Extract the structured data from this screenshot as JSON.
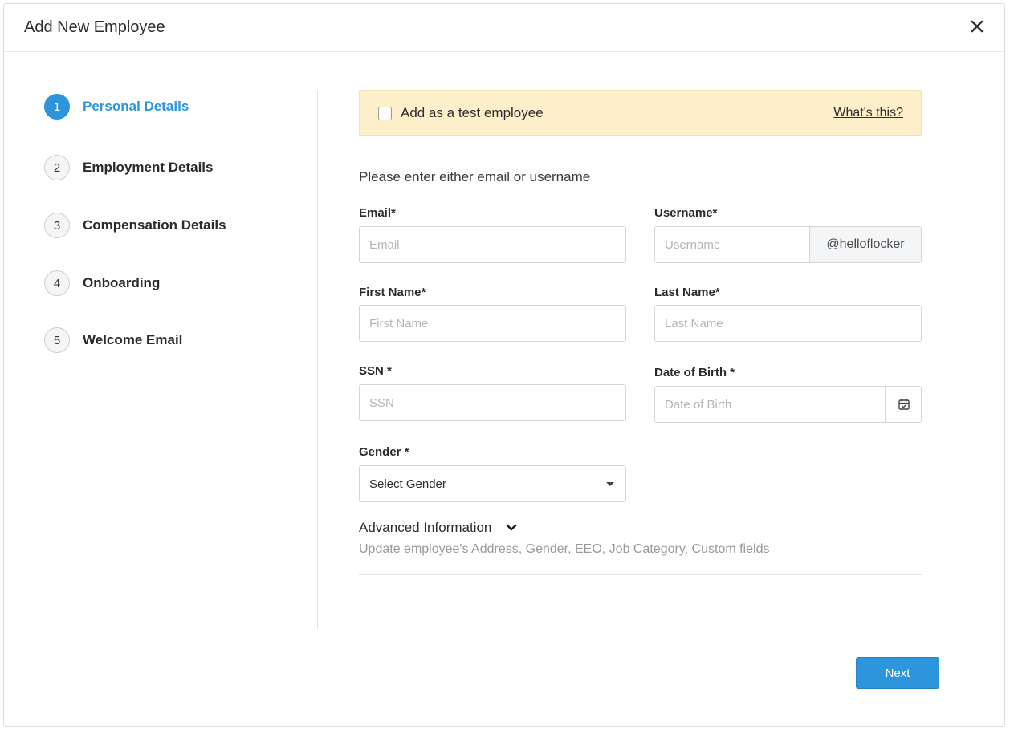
{
  "modal": {
    "title": "Add New Employee",
    "close_icon": "close-icon"
  },
  "steps": [
    {
      "number": "1",
      "label": "Personal Details",
      "active": true
    },
    {
      "number": "2",
      "label": "Employment Details",
      "active": false
    },
    {
      "number": "3",
      "label": "Compensation Details",
      "active": false
    },
    {
      "number": "4",
      "label": "Onboarding",
      "active": false
    },
    {
      "number": "5",
      "label": "Welcome Email",
      "active": false
    }
  ],
  "test_banner": {
    "label": "Add as a test employee",
    "checked": false,
    "link": "What's this?"
  },
  "form": {
    "instructions": "Please enter either email or username",
    "email": {
      "label": "Email*",
      "placeholder": "Email",
      "value": ""
    },
    "username": {
      "label": "Username*",
      "placeholder": "Username",
      "value": "",
      "suffix": "@helloflocker"
    },
    "first_name": {
      "label": "First Name*",
      "placeholder": "First Name",
      "value": ""
    },
    "last_name": {
      "label": "Last Name*",
      "placeholder": "Last Name",
      "value": ""
    },
    "ssn": {
      "label": "SSN *",
      "placeholder": "SSN",
      "value": ""
    },
    "dob": {
      "label": "Date of Birth *",
      "placeholder": "Date of Birth",
      "value": "",
      "icon": "calendar-icon"
    },
    "gender": {
      "label": "Gender *",
      "selected": "Select Gender"
    }
  },
  "advanced": {
    "title": "Advanced Information",
    "subtitle": "Update employee's Address, Gender, EEO, Job Category, Custom fields",
    "icon": "chevron-down-icon"
  },
  "footer": {
    "next_label": "Next"
  },
  "colors": {
    "accent": "#2d95dc",
    "banner": "#fdefc9"
  }
}
